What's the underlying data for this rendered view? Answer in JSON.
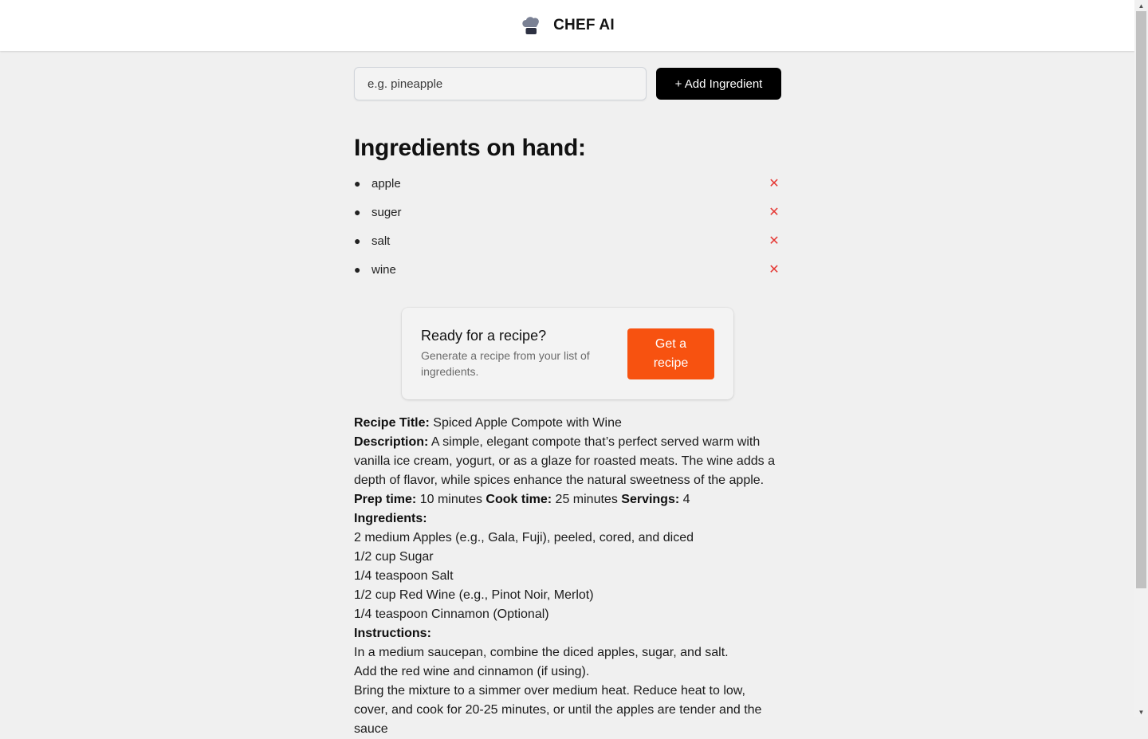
{
  "header": {
    "title": "CHEF AI",
    "logo_icon": "chef-hat-icon"
  },
  "add_form": {
    "placeholder": "e.g. pineapple",
    "button_label": "+ Add Ingredient"
  },
  "ingredients": {
    "heading": "Ingredients on hand:",
    "items": [
      "apple",
      "suger",
      "salt",
      "wine"
    ],
    "remove_symbol": "✕",
    "remove_color": "#e53935"
  },
  "cta": {
    "title": "Ready for a recipe?",
    "subtitle": "Generate a recipe from your list of ingredients.",
    "button_label": "Get a recipe",
    "button_color": "#f75210"
  },
  "recipe": {
    "title_label": "Recipe Title:",
    "title": "Spiced Apple Compote with Wine",
    "description_label": "Description:",
    "description": "A simple, elegant compote that’s perfect served warm with vanilla ice cream, yogurt, or as a glaze for roasted meats. The wine adds a depth of flavor, while spices enhance the natural sweetness of the apple.",
    "prep_label": "Prep time:",
    "prep": "10 minutes",
    "cook_label": "Cook time:",
    "cook": "25 minutes",
    "servings_label": "Servings:",
    "servings": "4",
    "ingredients_label": "Ingredients:",
    "ingredients": [
      "2 medium Apples (e.g., Gala, Fuji), peeled, cored, and diced",
      "1/2 cup Sugar",
      "1/4 teaspoon Salt",
      "1/2 cup Red Wine (e.g., Pinot Noir, Merlot)",
      "1/4 teaspoon Cinnamon (Optional)"
    ],
    "instructions_label": "Instructions:",
    "instructions": [
      "In a medium saucepan, combine the diced apples, sugar, and salt.",
      "Add the red wine and cinnamon (if using).",
      "Bring the mixture to a simmer over medium heat. Reduce heat to low, cover, and cook for 20-25 minutes, or until the apples are tender and the sauce"
    ]
  }
}
